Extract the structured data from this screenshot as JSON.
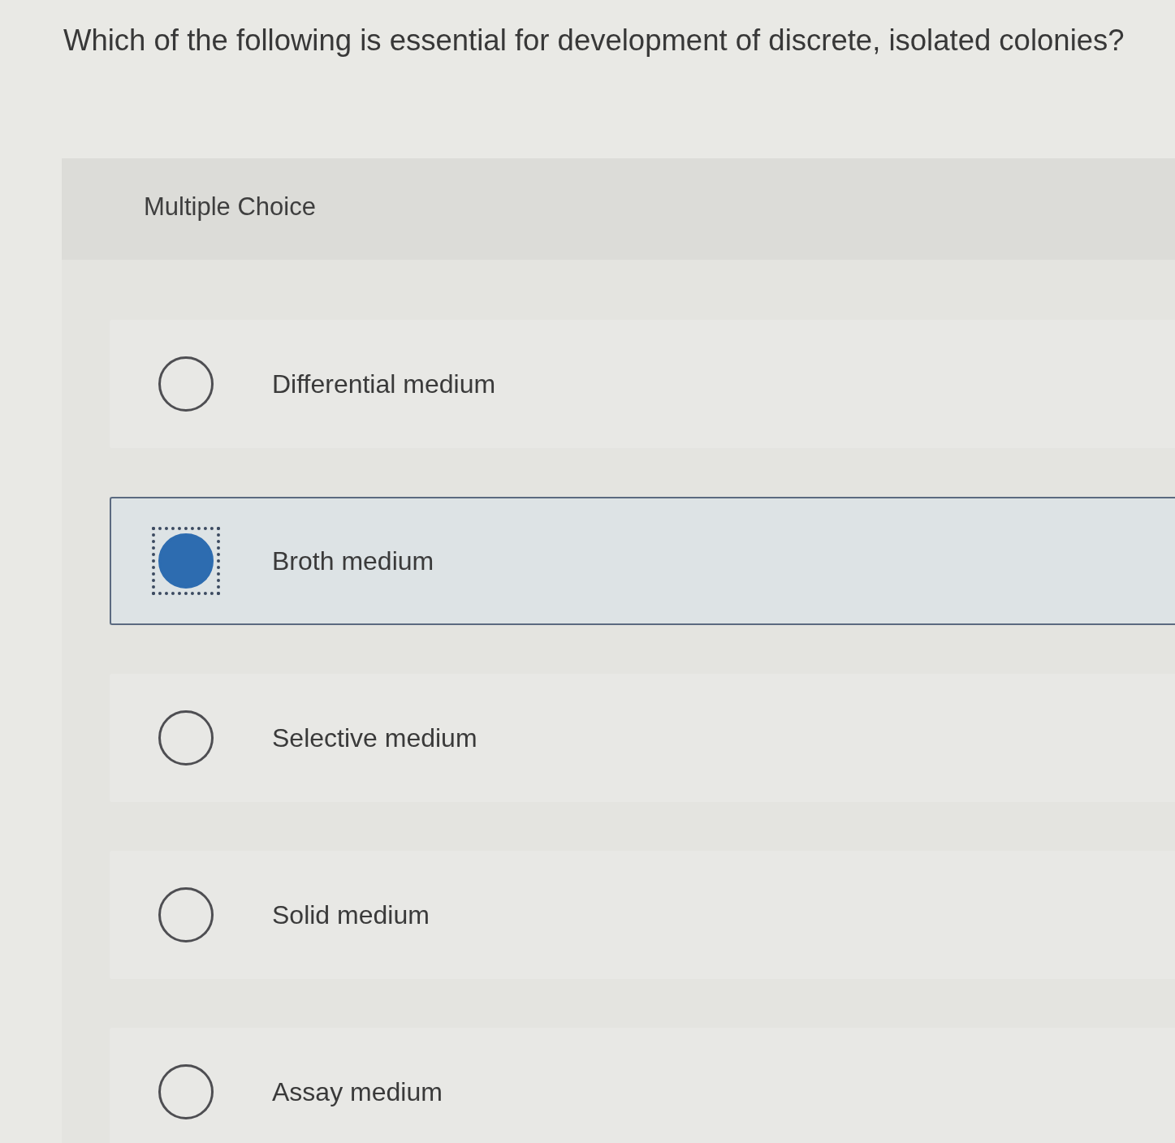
{
  "question": "Which of the following is essential for development of discrete, isolated colonies?",
  "multiple_choice": {
    "label": "Multiple Choice",
    "options": [
      {
        "label": "Differential medium",
        "selected": false,
        "focused": false
      },
      {
        "label": "Broth medium",
        "selected": true,
        "focused": true
      },
      {
        "label": "Selective medium",
        "selected": false,
        "focused": false
      },
      {
        "label": "Solid medium",
        "selected": false,
        "focused": false
      },
      {
        "label": "Assay medium",
        "selected": false,
        "focused": false
      }
    ]
  }
}
